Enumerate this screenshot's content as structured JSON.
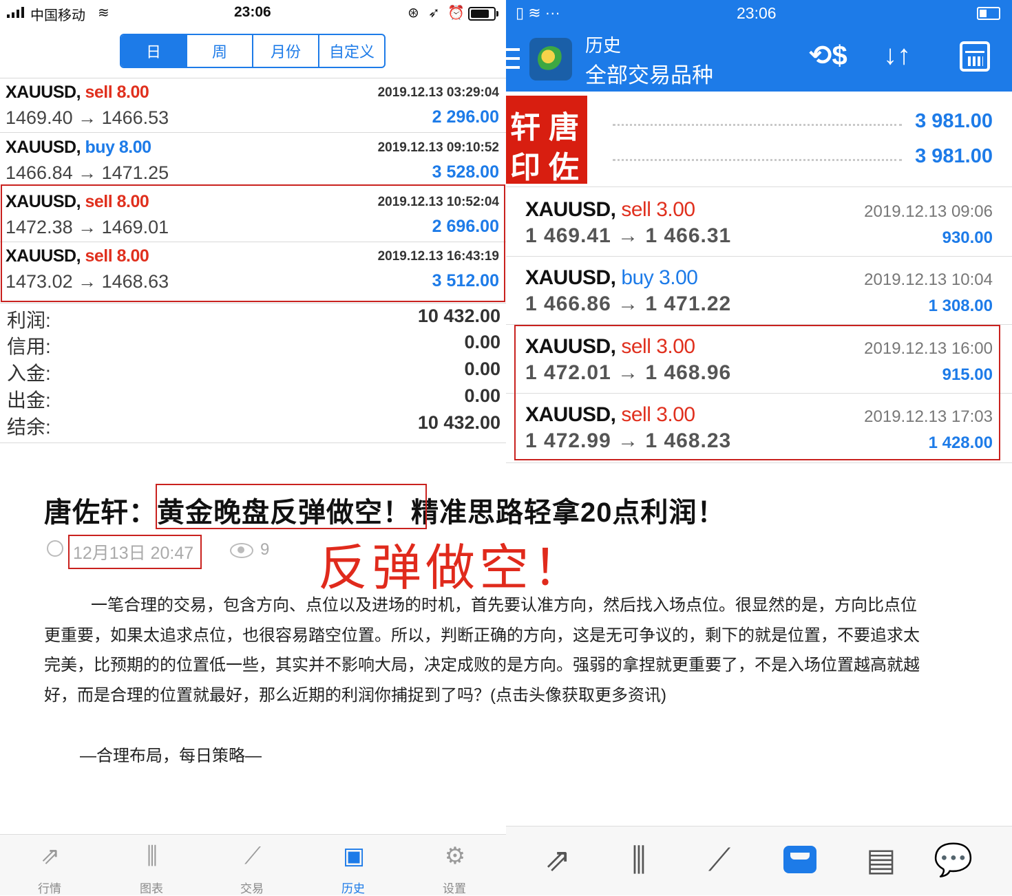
{
  "left": {
    "status": {
      "carrier": "中国移动",
      "time": "23:06"
    },
    "segments": [
      "日",
      "周",
      "月份",
      "自定义"
    ],
    "trades": [
      {
        "symbol": "XAUUSD,",
        "side": "sell",
        "volume": "8.00",
        "datetime": "2019.12.13 03:29:04",
        "prices": "1469.40 → 1466.53",
        "profit": "2 296.00"
      },
      {
        "symbol": "XAUUSD,",
        "side": "buy",
        "volume": "8.00",
        "datetime": "2019.12.13 09:10:52",
        "prices": "1466.84 → 1471.25",
        "profit": "3 528.00"
      },
      {
        "symbol": "XAUUSD,",
        "side": "sell",
        "volume": "8.00",
        "datetime": "2019.12.13 10:52:04",
        "prices": "1472.38 → 1469.01",
        "profit": "2 696.00"
      },
      {
        "symbol": "XAUUSD,",
        "side": "sell",
        "volume": "8.00",
        "datetime": "2019.12.13 16:43:19",
        "prices": "1473.02 → 1468.63",
        "profit": "3 512.00"
      }
    ],
    "summary": [
      {
        "label": "利润:",
        "value": "10 432.00"
      },
      {
        "label": "信用:",
        "value": "0.00"
      },
      {
        "label": "入金:",
        "value": "0.00"
      },
      {
        "label": "出金:",
        "value": "0.00"
      },
      {
        "label": "结余:",
        "value": "10 432.00"
      }
    ],
    "tabs": [
      {
        "label": "行情",
        "icon": "quotes-icon"
      },
      {
        "label": "图表",
        "icon": "chart-icon"
      },
      {
        "label": "交易",
        "icon": "trade-icon"
      },
      {
        "label": "历史",
        "icon": "history-icon"
      },
      {
        "label": "设置",
        "icon": "settings-icon"
      }
    ]
  },
  "article": {
    "title_prefix": "唐佐轩：",
    "title_highlight": "黄金晚盘反弹做空！",
    "title_suffix": "精准思路轻拿20点利润！",
    "date": "12月13日 20:47",
    "views": "9",
    "stamp_text": "反弹做空！",
    "paragraph": "一笔合理的交易，包含方向、点位以及进场的时机，首先要认准方向，然后找入场点位。很显然的是，方向比点位更重要，如果太追求点位，也很容易踏空位置。所以，判断正确的方向，这是无可争议的，剩下的就是位置，不要追求太完美，比预期的的位置低一些，其实并不影响大局，决定成败的是方向。强弱的拿捏就更重要了，不是入场位置越高就越好，而是合理的位置就最好，那么近期的利润你捕捉到了吗？(点击头像获取更多资讯)",
    "slogan": "—合理布局，每日策略—"
  },
  "right": {
    "status": {
      "icons": "▯ ≋ ···",
      "time": "23:06"
    },
    "header": {
      "title": "历史",
      "subtitle": "全部交易品种"
    },
    "balances": [
      "3 981.00",
      "3 981.00"
    ],
    "seal_chars": [
      "轩",
      "唐",
      "印",
      "佐"
    ],
    "trades": [
      {
        "symbol": "XAUUSD,",
        "side": "sell",
        "volume": "3.00",
        "datetime": "2019.12.13 09:06",
        "prices": "1 469.41 → 1 466.31",
        "profit": "930.00"
      },
      {
        "symbol": "XAUUSD,",
        "side": "buy",
        "volume": "3.00",
        "datetime": "2019.12.13 10:04",
        "prices": "1 466.86 → 1 471.22",
        "profit": "1 308.00"
      },
      {
        "symbol": "XAUUSD,",
        "side": "sell",
        "volume": "3.00",
        "datetime": "2019.12.13 16:00",
        "prices": "1 472.01 → 1 468.96",
        "profit": "915.00"
      },
      {
        "symbol": "XAUUSD,",
        "side": "sell",
        "volume": "3.00",
        "datetime": "2019.12.13 17:03",
        "prices": "1 472.99 → 1 468.23",
        "profit": "1 428.00"
      }
    ]
  },
  "colors": {
    "accent": "#1d7be8",
    "sell": "#e0301e",
    "highlight_box": "#c9211e"
  }
}
